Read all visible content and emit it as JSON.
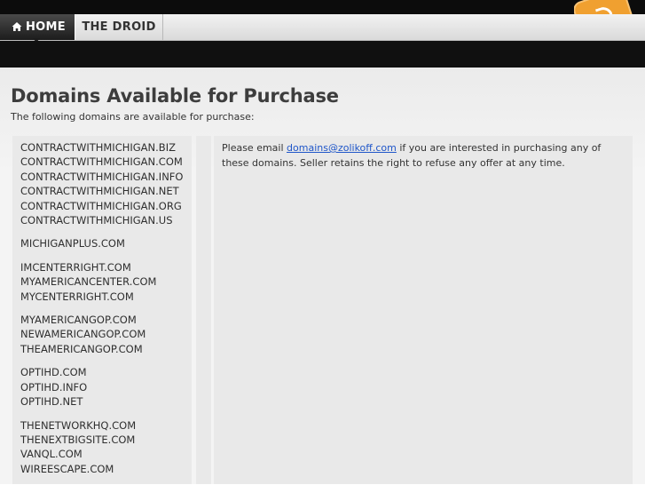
{
  "nav": {
    "items": [
      {
        "label": "HOME",
        "icon": "home-icon",
        "active": true
      },
      {
        "label": "THE DROID",
        "active": false
      }
    ]
  },
  "header": {
    "rss_icon": "rss-icon",
    "accent_color": "#f0a030"
  },
  "page": {
    "title": "Domains Available for Purchase",
    "intro": "The following domains are available for purchase:"
  },
  "domain_groups": [
    [
      "CONTRACTWITHMICHIGAN.BIZ",
      "CONTRACTWITHMICHIGAN.COM",
      "CONTRACTWITHMICHIGAN.INFO",
      "CONTRACTWITHMICHIGAN.NET",
      "CONTRACTWITHMICHIGAN.ORG",
      "CONTRACTWITHMICHIGAN.US"
    ],
    [
      "MICHIGANPLUS.COM"
    ],
    [
      "IMCENTERRIGHT.COM",
      "MYAMERICANCENTER.COM",
      "MYCENTERRIGHT.COM"
    ],
    [
      "MYAMERICANGOP.COM",
      "NEWAMERICANGOP.COM",
      "THEAMERICANGOP.COM"
    ],
    [
      "OPTIHD.COM",
      "OPTIHD.INFO",
      "OPTIHD.NET"
    ],
    [
      "THENETWORKHQ.COM",
      "THENEXTBIGSITE.COM",
      "VANQL.COM",
      "WIREESCAPE.COM"
    ]
  ],
  "notice": {
    "before": "Please email ",
    "email": "domains@zolikoff.com",
    "after": " if you are interested in purchasing any of these domains.  Seller retains the right to refuse any offer at any time."
  }
}
